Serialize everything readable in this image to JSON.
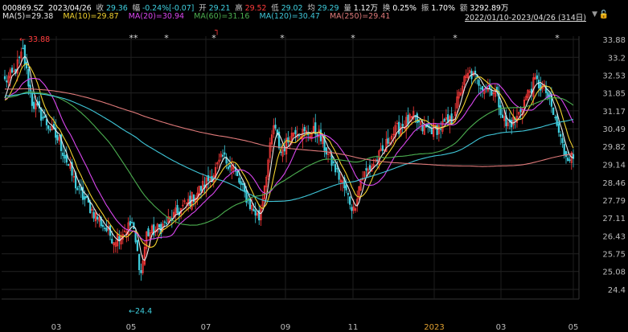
{
  "header": {
    "code": "000869.SZ",
    "date": "2023/04/26",
    "close_label": "收",
    "close": "29.36",
    "change_label": "幅",
    "change": "-0.24%[-0.07]",
    "open_label": "开",
    "open": "29.21",
    "high_label": "高",
    "high": "29.52",
    "low_label": "低",
    "low": "29.02",
    "avg_label": "均",
    "avg": "29.29",
    "vol_label": "量",
    "vol": "1.12万",
    "turn_label": "换",
    "turn": "0.25%",
    "amp_label": "振",
    "amp": "1.70%",
    "amt_label": "额",
    "amt": "3292.89万",
    "range": "2022/01/10-2023/04/26 (314日)",
    "colors": {
      "up": "#ff3b3b",
      "down": "#3fd0e0",
      "text": "#cccccc"
    }
  },
  "ma_legend": [
    {
      "label": "MA(5)=29.38",
      "color": "#e8e8e8"
    },
    {
      "label": "MA(10)=29.87",
      "color": "#f2d22e"
    },
    {
      "label": "MA(20)=30.94",
      "color": "#d946ef"
    },
    {
      "label": "MA(60)=31.16",
      "color": "#4caf50"
    },
    {
      "label": "MA(120)=30.47",
      "color": "#3fc6d8"
    },
    {
      "label": "MA(250)=29.41",
      "color": "#e07a7a"
    }
  ],
  "chart_data": {
    "type": "candlestick",
    "ylim": [
      24.35,
      34.2
    ],
    "y_ticks": [
      "33.88",
      "33.2",
      "32.53",
      "31.85",
      "31.17",
      "30.49",
      "29.82",
      "29.14",
      "28.46",
      "27.79",
      "27.11",
      "26.43",
      "25.75",
      "25.08",
      "24.4"
    ],
    "x_ticks": [
      "03",
      "05",
      "07",
      "09",
      "11",
      "2023",
      "03",
      "05"
    ],
    "max_label": "33.88",
    "min_label": "24.4",
    "star_marks": [
      "**",
      "*",
      "*",
      "*",
      "*",
      "*",
      "*"
    ],
    "flag_mark": "┐",
    "anchors": [
      [
        0,
        32.3
      ],
      [
        5,
        32.6
      ],
      [
        10,
        33.4
      ],
      [
        15,
        31.5
      ],
      [
        22,
        30.8
      ],
      [
        30,
        30.0
      ],
      [
        40,
        28.2
      ],
      [
        50,
        27.2
      ],
      [
        60,
        26.3
      ],
      [
        70,
        26.9
      ],
      [
        75,
        25.0
      ],
      [
        78,
        26.5
      ],
      [
        85,
        26.7
      ],
      [
        95,
        27.3
      ],
      [
        105,
        28.0
      ],
      [
        115,
        28.8
      ],
      [
        120,
        29.4
      ],
      [
        125,
        29.1
      ],
      [
        130,
        28.3
      ],
      [
        135,
        27.6
      ],
      [
        140,
        27.1
      ],
      [
        148,
        30.6
      ],
      [
        152,
        29.6
      ],
      [
        160,
        30.5
      ],
      [
        165,
        30.3
      ],
      [
        172,
        30.4
      ],
      [
        178,
        29.5
      ],
      [
        186,
        28.4
      ],
      [
        192,
        27.4
      ],
      [
        196,
        28.6
      ],
      [
        202,
        29.1
      ],
      [
        208,
        29.6
      ],
      [
        212,
        30.2
      ],
      [
        218,
        30.6
      ],
      [
        225,
        30.9
      ],
      [
        230,
        30.5
      ],
      [
        238,
        30.5
      ],
      [
        246,
        30.8
      ],
      [
        252,
        32.2
      ],
      [
        256,
        32.6
      ],
      [
        262,
        32.2
      ],
      [
        270,
        31.9
      ],
      [
        276,
        30.6
      ],
      [
        282,
        30.9
      ],
      [
        287,
        31.7
      ],
      [
        292,
        32.3
      ],
      [
        298,
        31.9
      ],
      [
        304,
        30.6
      ],
      [
        308,
        29.6
      ],
      [
        313,
        29.36
      ]
    ],
    "ma_series": [
      {
        "name": "MA(5)",
        "color": "#e8e8e8",
        "period": 5
      },
      {
        "name": "MA(10)",
        "color": "#f2d22e",
        "period": 10
      },
      {
        "name": "MA(20)",
        "color": "#d946ef",
        "period": 20
      },
      {
        "name": "MA(60)",
        "color": "#4caf50",
        "period": 60
      },
      {
        "name": "MA(120)",
        "color": "#3fc6d8",
        "period": 120
      },
      {
        "name": "MA(250)",
        "color": "#e07a7a",
        "period": 250
      }
    ]
  }
}
